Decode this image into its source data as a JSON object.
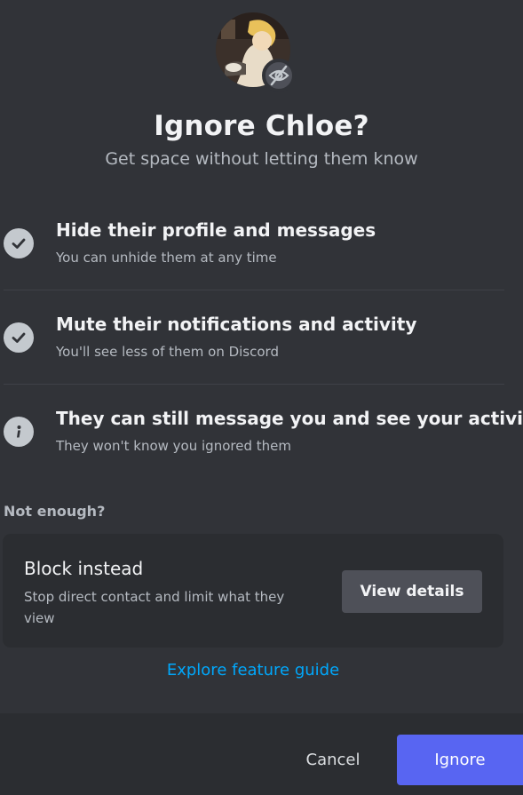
{
  "dialog": {
    "title": "Ignore Chloe?",
    "subtitle": "Get space without letting them know"
  },
  "avatar": {
    "badge_icon": "eye-slash-icon"
  },
  "items": [
    {
      "icon": "check-circle-icon",
      "title": "Hide their profile and messages",
      "subtitle": "You can unhide them at any time"
    },
    {
      "icon": "check-circle-icon",
      "title": "Mute their notifications and activity",
      "subtitle": "You'll see less of them on Discord"
    },
    {
      "icon": "info-circle-icon",
      "title": "They can still message you and see your activity",
      "subtitle": "They won't know you ignored them"
    }
  ],
  "block_section": {
    "heading": "Not enough?",
    "title": "Block instead",
    "description": "Stop direct contact and limit what they view",
    "button_label": "View details"
  },
  "explore_link": "Explore feature guide",
  "footer": {
    "cancel_label": "Cancel",
    "ignore_label": "Ignore"
  },
  "colors": {
    "background": "#313338",
    "card": "#2b2d31",
    "primary": "#5865f2",
    "link": "#00a8fc"
  }
}
